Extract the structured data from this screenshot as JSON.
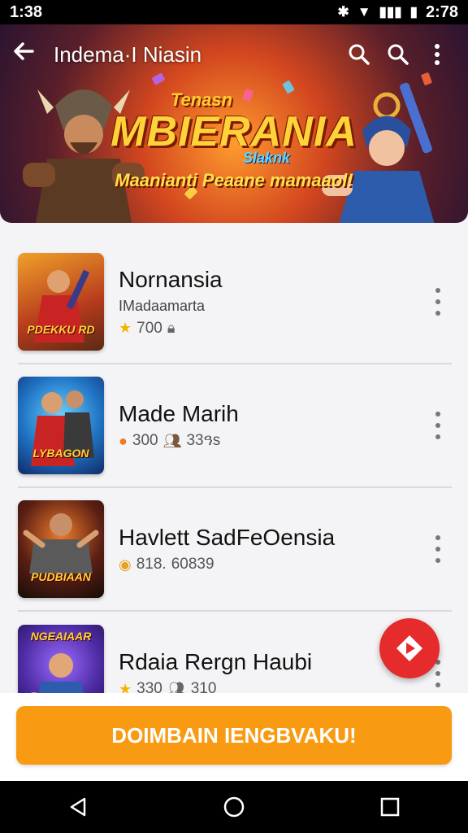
{
  "status_bar": {
    "time_left": "1:38",
    "time_right": "2:78"
  },
  "header": {
    "title": "Indema·I Niasin"
  },
  "banner": {
    "kicker": "Tenasn",
    "headline": "MBIERANIA",
    "sub": "Slaknk",
    "tagline": "Maanianti Peaane mamaaol!"
  },
  "games": [
    {
      "title": "Nornansia",
      "subtitle": "IMadaamarta",
      "meta_icon": "star-icon",
      "meta1": "700",
      "meta2_icon": "lock-icon",
      "meta2": "",
      "thumb_text": "PDEKKU RD",
      "thumb_bg": "#c9641e"
    },
    {
      "title": "Made Marih",
      "subtitle": "",
      "meta_icon": "fire-icon",
      "meta1": "300",
      "meta2_icon": "users-icon",
      "meta2": "33ዓs",
      "thumb_text": "LYBAGON",
      "thumb_bg": "#1f72c2"
    },
    {
      "title": "Havlett SadFeOensia",
      "subtitle": "",
      "meta_icon": "location-icon",
      "meta1": "818.",
      "meta2_icon": "",
      "meta2": "60839",
      "thumb_text": "PUDBIAAN",
      "thumb_bg": "#2a1b12"
    },
    {
      "title": "Rdaia Rergn Haubi",
      "subtitle": "",
      "meta_icon": "star-icon",
      "meta1": "330",
      "meta2_icon": "users-icon",
      "meta2": "310",
      "thumb_text": "NGEAIAAR",
      "thumb_bg": "#4b2aa0"
    }
  ],
  "cta": {
    "label": "DOIMBAIN IENGBVAKU!"
  },
  "colors": {
    "accent": "#f99b12",
    "fab": "#e52b2b"
  }
}
